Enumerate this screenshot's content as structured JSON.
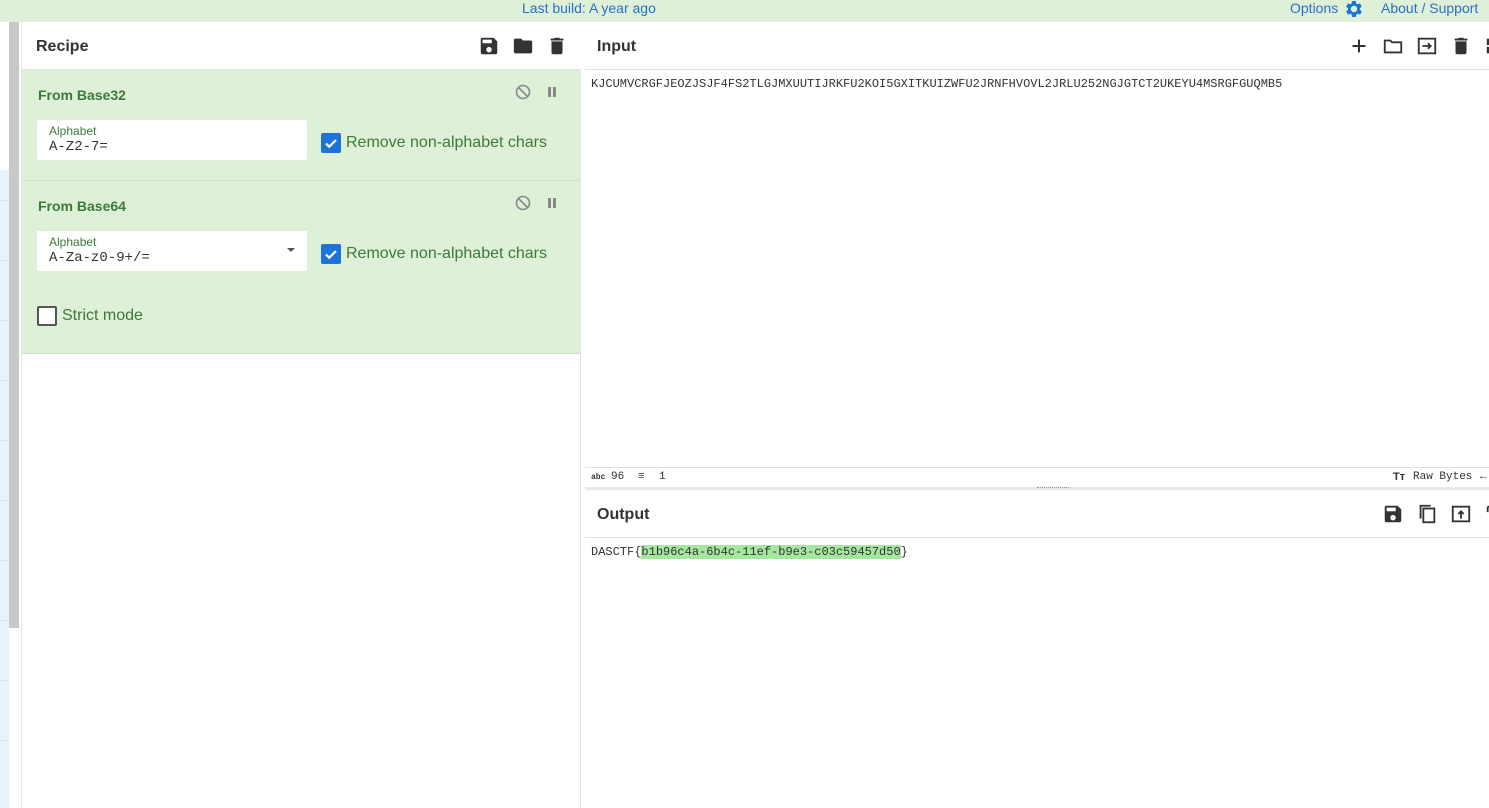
{
  "banner": {
    "last_build": "Last build: A year ago",
    "options": "Options",
    "about": "About / Support"
  },
  "recipe": {
    "title": "Recipe",
    "operations": [
      {
        "name": "From Base32",
        "alphabet_label": "Alphabet",
        "alphabet_value": "A-Z2-7=",
        "remove_label": "Remove non-alphabet chars",
        "remove_checked": true
      },
      {
        "name": "From Base64",
        "alphabet_label": "Alphabet",
        "alphabet_value": "A-Za-z0-9+/=",
        "remove_label": "Remove non-alphabet chars",
        "remove_checked": true,
        "strict_label": "Strict mode",
        "strict_checked": false
      }
    ]
  },
  "input": {
    "title": "Input",
    "text": "KJCUMVCRGFJEOZJSJF4FS2TLGJMXUUTIJRKFU2KOI5GXITKUIZWFU2JRNFHVOVL2JRLU252NGJGTCT2UKEYU4MSRGFGUQMB5"
  },
  "status": {
    "chars_icon": "abc",
    "chars": "96",
    "lines": "1",
    "format": "Raw Bytes"
  },
  "output": {
    "title": "Output",
    "prefix": "DASCTF{",
    "highlight": "b1b96c4a-6b4c-11ef-b9e3-c03c59457d50",
    "suffix": "}"
  },
  "colors": {
    "accent": "#1e73d8",
    "recipe_bg": "#dff0d8",
    "op_title": "#3c7a3a",
    "highlight": "#a6e7a0"
  }
}
